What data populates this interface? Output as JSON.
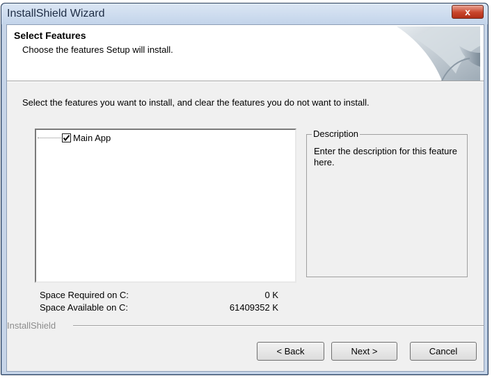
{
  "window": {
    "title": "InstallShield Wizard",
    "close_label": "x"
  },
  "header": {
    "title": "Select Features",
    "subtitle": "Choose the features Setup will install."
  },
  "instruction": "Select the features you want to install, and clear the features you do not want to install.",
  "feature_tree": {
    "items": [
      {
        "label": "Main App",
        "checked": true
      }
    ]
  },
  "description": {
    "legend": "Description",
    "text": "Enter the description for this feature here."
  },
  "space": {
    "required_label": "Space Required on  C:",
    "required_value": "0 K",
    "available_label": "Space Available on  C:",
    "available_value": "61409352 K"
  },
  "brand": "InstallShield",
  "buttons": {
    "back": "< Back",
    "next": "Next >",
    "cancel": "Cancel"
  }
}
